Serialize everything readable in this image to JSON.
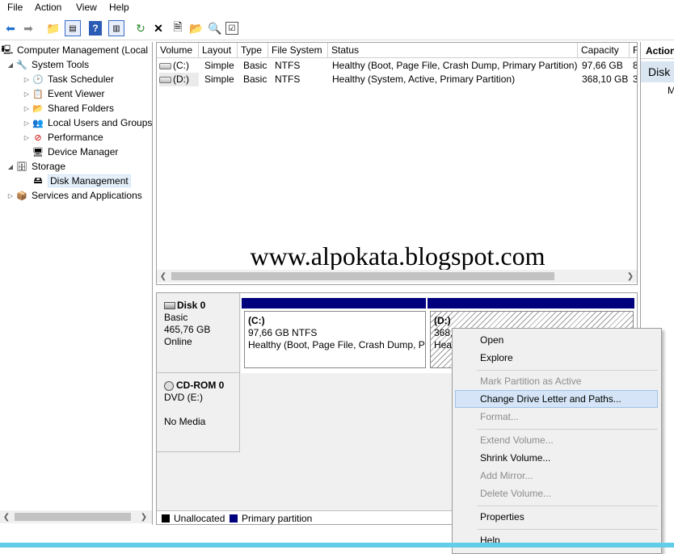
{
  "menu": [
    "File",
    "Action",
    "View",
    "Help"
  ],
  "toolbar_icons": [
    "back-arrow-icon",
    "forward-arrow-icon",
    "up-folder-icon",
    "show-hide-tree-icon",
    "help-icon",
    "show-hide-action-pane-icon",
    "refresh-icon",
    "delete-icon",
    "properties-icon",
    "open-icon",
    "search-icon",
    "checklist-icon"
  ],
  "tree": {
    "root": "Computer Management (Local",
    "system_tools": "System Tools",
    "task_scheduler": "Task Scheduler",
    "event_viewer": "Event Viewer",
    "shared_folders": "Shared Folders",
    "local_users": "Local Users and Groups",
    "performance": "Performance",
    "device_manager": "Device Manager",
    "storage": "Storage",
    "disk_management": "Disk Management",
    "services": "Services and Applications"
  },
  "columns": [
    "Volume",
    "Layout",
    "Type",
    "File System",
    "Status",
    "Capacity",
    "F"
  ],
  "volumes": [
    {
      "volume": "(C:)",
      "layout": "Simple",
      "type": "Basic",
      "fs": "NTFS",
      "status": "Healthy (Boot, Page File, Crash Dump, Primary Partition)",
      "capacity": "97,66 GB",
      "free": "8"
    },
    {
      "volume": "(D:)",
      "layout": "Simple",
      "type": "Basic",
      "fs": "NTFS",
      "status": "Healthy (System, Active, Primary Partition)",
      "capacity": "368,10 GB",
      "free": "3"
    }
  ],
  "watermark": "www.alpokata.blogspot.com",
  "disk0": {
    "name": "Disk 0",
    "type": "Basic",
    "size": "465,76 GB",
    "state": "Online",
    "c_title": "(C:)",
    "c_size": "97,66 GB NTFS",
    "c_status": "Healthy (Boot, Page File, Crash Dump, Pr",
    "d_title": "(D:)",
    "d_size": "368,",
    "d_status": "Heal"
  },
  "cdrom0": {
    "name": "CD-ROM 0",
    "drive": "DVD (E:)",
    "media": "No Media"
  },
  "legend": {
    "unallocated": "Unallocated",
    "primary": "Primary partition",
    "unallocated_color": "#000000",
    "primary_color": "#00007f"
  },
  "actions": {
    "header": "Action",
    "selected": "Disk",
    "more": "M"
  },
  "context_menu": {
    "open": "Open",
    "explore": "Explore",
    "mark_active": "Mark Partition as Active",
    "change_letter": "Change Drive Letter and Paths...",
    "format": "Format...",
    "extend": "Extend Volume...",
    "shrink": "Shrink Volume...",
    "add_mirror": "Add Mirror...",
    "delete": "Delete Volume...",
    "properties": "Properties",
    "help": "Help"
  }
}
